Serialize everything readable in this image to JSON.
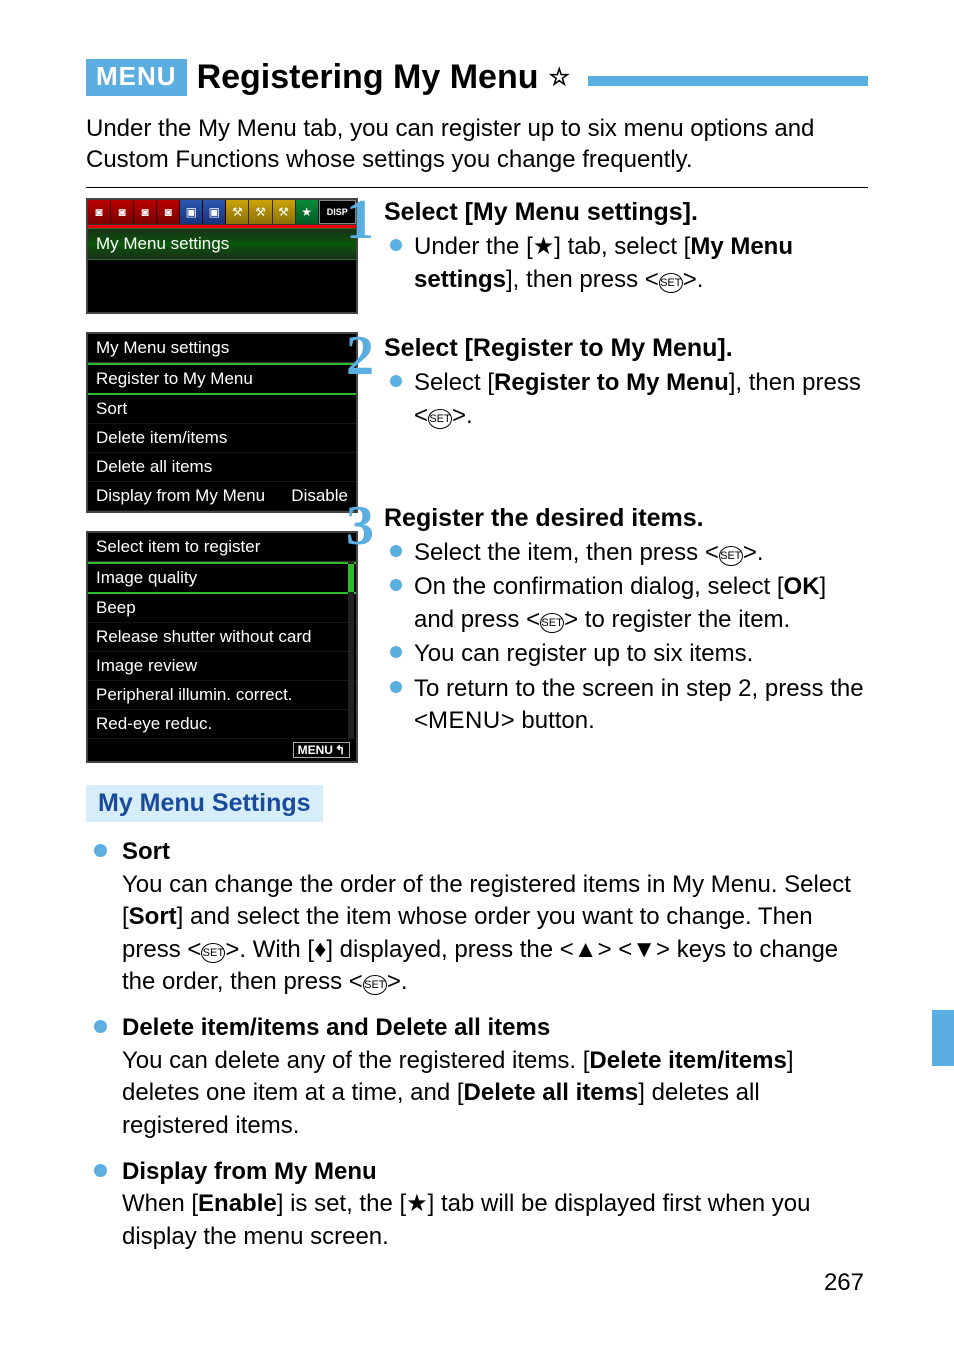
{
  "title": {
    "badge": "MENU",
    "text": "Registering My Menu",
    "star": "☆"
  },
  "intro": "Under the My Menu tab, you can register up to six menu options and Custom Functions whose settings you change frequently.",
  "screens": {
    "s1": {
      "disp_label": "DISP",
      "row_selected": "My Menu settings",
      "star": "★"
    },
    "s2": {
      "header": "My Menu settings",
      "i0": "Register to My Menu",
      "i1": "Sort",
      "i2": "Delete item/items",
      "i3": "Delete all items",
      "i4_l": "Display from My Menu",
      "i4_r": "Disable"
    },
    "s3": {
      "header": "Select item to register",
      "i0": "Image quality",
      "i1": "Beep",
      "i2": "Release shutter without card",
      "i3": "Image review",
      "i4": "Peripheral illumin. correct.",
      "i5": "Red-eye reduc.",
      "menu_btn": "MENU",
      "back_glyph": "↰"
    }
  },
  "steps": {
    "n1": "1",
    "n2": "2",
    "n3": "3",
    "s1_title": "Select [My Menu settings].",
    "s1_b1_a": "Under the [",
    "s1_b1_star": "★",
    "s1_b1_b": "] tab, select [",
    "s1_b1_bold": "My Menu settings",
    "s1_b1_c": "], then press <",
    "s1_b1_end": ">.",
    "s2_title": "Select [Register to My Menu].",
    "s2_b1_a": "Select [",
    "s2_b1_bold": "Register to My Menu",
    "s2_b1_b": "], then press <",
    "s2_b1_end": ">.",
    "s3_title": "Register the desired items.",
    "s3_b1_a": "Select the item, then press <",
    "s3_b1_end": ">.",
    "s3_b2_a": "On the confirmation dialog, select [",
    "s3_b2_bold": "OK",
    "s3_b2_b": "] and press <",
    "s3_b2_c": "> to register the item.",
    "s3_b3": "You can register up to six items.",
    "s3_b4_a": "To return to the screen in step 2, press the <",
    "s3_b4_menu": "MENU",
    "s3_b4_b": "> button."
  },
  "set_label": "SET",
  "sub_heading": "My Menu Settings",
  "settings": {
    "sort_t": "Sort",
    "sort_a": "You can change the order of the registered items in My Menu. Select [",
    "sort_bold1": "Sort",
    "sort_b": "] and select the item whose order you want to change. Then press <",
    "sort_c": ">. With [",
    "sort_updown": "♦",
    "sort_d": "] displayed, press the <",
    "sort_up": "▲",
    "sort_e": "> <",
    "sort_down": "▼",
    "sort_f": "> keys to change the order, then press <",
    "sort_end": ">.",
    "del_t": "Delete item/items and Delete all items",
    "del_a": "You can delete any of the registered items. [",
    "del_bold1": "Delete item/items",
    "del_b": "] deletes one item at a time, and [",
    "del_bold2": "Delete all items",
    "del_c": "] deletes all registered items.",
    "disp_t": "Display from My Menu",
    "disp_a": "When [",
    "disp_bold": "Enable",
    "disp_b": "] is set, the [",
    "disp_star": "★",
    "disp_c": "] tab will be displayed first when you display the menu screen."
  },
  "page_number": "267"
}
